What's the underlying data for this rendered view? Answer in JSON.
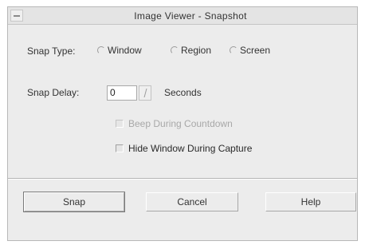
{
  "window": {
    "title": "Image Viewer - Snapshot"
  },
  "snap_type": {
    "label": "Snap Type:",
    "options": [
      {
        "label": "Window",
        "selected": false
      },
      {
        "label": "Region",
        "selected": false
      },
      {
        "label": "Screen",
        "selected": false
      }
    ]
  },
  "snap_delay": {
    "label": "Snap Delay:",
    "value": "0",
    "unit": "Seconds"
  },
  "checkboxes": {
    "beep": {
      "label": "Beep During Countdown",
      "checked": false,
      "enabled": false
    },
    "hide": {
      "label": "Hide Window During Capture",
      "checked": false,
      "enabled": true
    }
  },
  "buttons": {
    "snap": "Snap",
    "cancel": "Cancel",
    "help": "Help"
  },
  "icons": {
    "window_menu": "window-menu-icon",
    "spinner": "spinner-arrow-icon"
  }
}
